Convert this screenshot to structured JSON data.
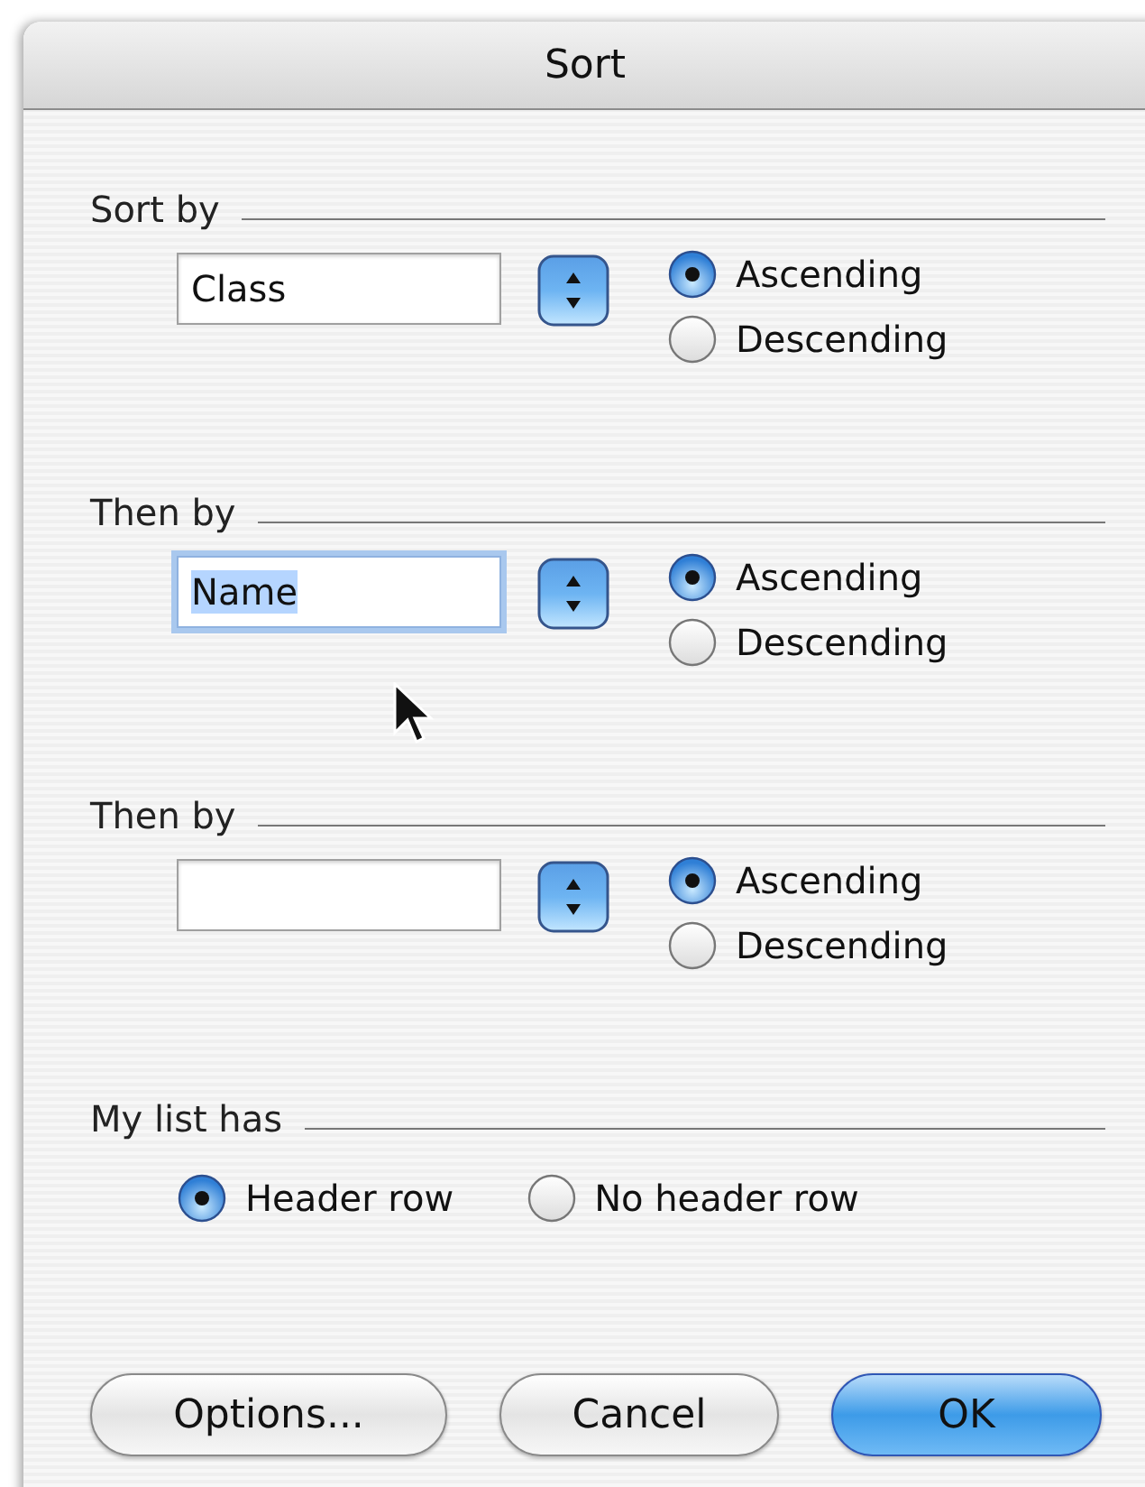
{
  "window": {
    "title": "Sort"
  },
  "sort_levels": [
    {
      "heading": "Sort by",
      "field": {
        "value": "Class",
        "focused": false
      },
      "options": [
        {
          "label": "Ascending",
          "selected": true
        },
        {
          "label": "Descending",
          "selected": false
        }
      ]
    },
    {
      "heading": "Then by",
      "field": {
        "value": "Name",
        "focused": true
      },
      "options": [
        {
          "label": "Ascending",
          "selected": true
        },
        {
          "label": "Descending",
          "selected": false
        }
      ]
    },
    {
      "heading": "Then by",
      "field": {
        "focused": false
      },
      "options": [
        {
          "label": "Ascending",
          "selected": true
        },
        {
          "label": "Descending",
          "selected": false
        }
      ]
    }
  ],
  "header": {
    "heading": "My list has",
    "options": [
      {
        "label": "Header row",
        "selected": true
      },
      {
        "label": "No header row",
        "selected": false
      }
    ]
  },
  "buttons": [
    {
      "label": "Options...",
      "default": false
    },
    {
      "label": "Cancel",
      "default": false
    },
    {
      "label": "OK",
      "default": true
    }
  ]
}
